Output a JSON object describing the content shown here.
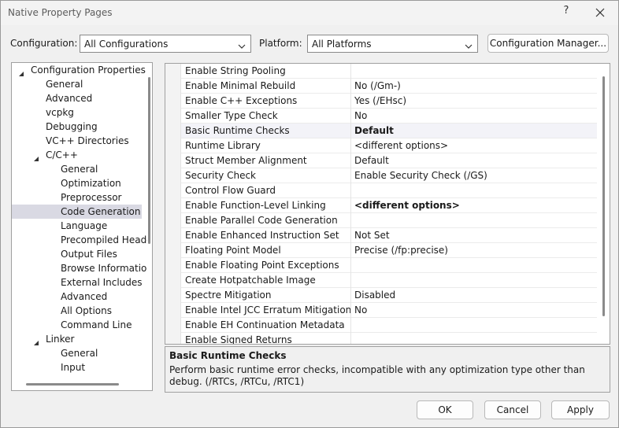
{
  "window": {
    "title": "Native Property Pages",
    "help": "?"
  },
  "header": {
    "configuration_label": "Configuration:",
    "configuration_value": "All Configurations",
    "platform_label": "Platform:",
    "platform_value": "All Platforms",
    "config_manager_label": "Configuration Manager..."
  },
  "tree": {
    "items": [
      {
        "label": "Configuration Properties",
        "expanded": true
      },
      {
        "label": "General"
      },
      {
        "label": "Advanced"
      },
      {
        "label": "vcpkg"
      },
      {
        "label": "Debugging"
      },
      {
        "label": "VC++ Directories"
      },
      {
        "label": "C/C++",
        "expanded": true
      },
      {
        "label": "General"
      },
      {
        "label": "Optimization"
      },
      {
        "label": "Preprocessor"
      },
      {
        "label": "Code Generation",
        "selected": true
      },
      {
        "label": "Language"
      },
      {
        "label": "Precompiled Heade"
      },
      {
        "label": "Output Files"
      },
      {
        "label": "Browse Information"
      },
      {
        "label": "External Includes"
      },
      {
        "label": "Advanced"
      },
      {
        "label": "All Options"
      },
      {
        "label": "Command Line"
      },
      {
        "label": "Linker",
        "expanded": true
      },
      {
        "label": "General"
      },
      {
        "label": "Input"
      }
    ]
  },
  "grid": {
    "rows": [
      {
        "name": "Enable String Pooling",
        "value": ""
      },
      {
        "name": "Enable Minimal Rebuild",
        "value": "No (/Gm-)"
      },
      {
        "name": "Enable C++ Exceptions",
        "value": "Yes (/EHsc)"
      },
      {
        "name": "Smaller Type Check",
        "value": "No"
      },
      {
        "name": "Basic Runtime Checks",
        "value": "Default",
        "bold": true
      },
      {
        "name": "Runtime Library",
        "value": "<different options>"
      },
      {
        "name": "Struct Member Alignment",
        "value": "Default"
      },
      {
        "name": "Security Check",
        "value": "Enable Security Check (/GS)"
      },
      {
        "name": "Control Flow Guard",
        "value": ""
      },
      {
        "name": "Enable Function-Level Linking",
        "value": "<different options>",
        "bold": true
      },
      {
        "name": "Enable Parallel Code Generation",
        "value": ""
      },
      {
        "name": "Enable Enhanced Instruction Set",
        "value": "Not Set"
      },
      {
        "name": "Floating Point Model",
        "value": "Precise (/fp:precise)"
      },
      {
        "name": "Enable Floating Point Exceptions",
        "value": ""
      },
      {
        "name": "Create Hotpatchable Image",
        "value": ""
      },
      {
        "name": "Spectre Mitigation",
        "value": "Disabled"
      },
      {
        "name": "Enable Intel JCC Erratum Mitigation",
        "value": "No"
      },
      {
        "name": "Enable EH Continuation Metadata",
        "value": ""
      },
      {
        "name": "Enable Signed Returns",
        "value": ""
      }
    ]
  },
  "description": {
    "title": "Basic Runtime Checks",
    "text": "Perform basic runtime error checks, incompatible with any optimization type other than debug. (/RTCs, /RTCu, /RTC1)"
  },
  "footer": {
    "ok_label": "OK",
    "cancel_label": "Cancel",
    "apply_label": "Apply"
  }
}
